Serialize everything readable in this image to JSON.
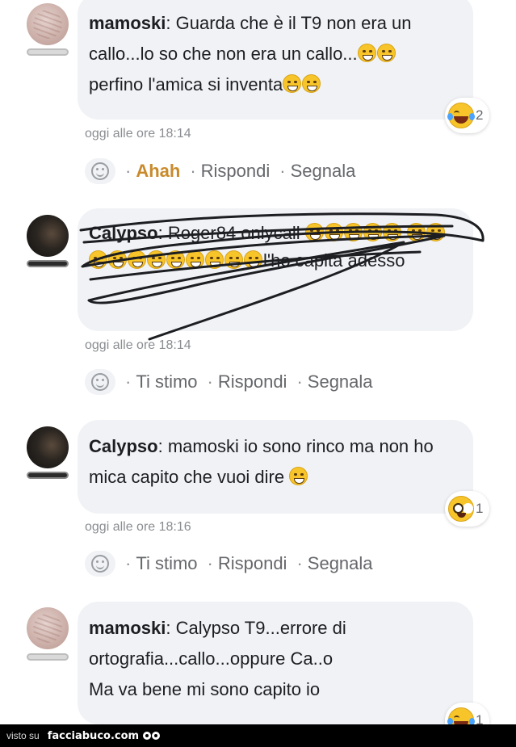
{
  "comments": [
    {
      "author": "mamoski",
      "text_before_emoji": ": Guarda che è il T9 non era un callo...lo so che non era un callo...",
      "text_line3": "perfino l'amica si inventa",
      "reaction": {
        "icon": "laugh-tears-reaction-icon",
        "count": "2"
      },
      "timestamp": "oggi alle ore 18:14",
      "actions": {
        "react": "Ahah",
        "reply": "Rispondi",
        "report": "Segnala"
      },
      "react_active": true
    },
    {
      "author": "Calypso",
      "text": ": Roger84 onlycall",
      "text_tail": "l'ho capita adesso",
      "timestamp": "oggi alle ore 18:14",
      "actions": {
        "react": "Ti stimo",
        "reply": "Rispondi",
        "report": "Segnala"
      },
      "react_active": false,
      "scribbled_out": true
    },
    {
      "author": "Calypso",
      "text": ": mamoski io sono rinco ma non ho mica capito che vuoi dire",
      "reaction": {
        "icon": "wow-reaction-icon",
        "count": "1"
      },
      "timestamp": "oggi alle ore 18:16",
      "actions": {
        "react": "Ti stimo",
        "reply": "Rispondi",
        "report": "Segnala"
      },
      "react_active": false
    },
    {
      "author": "mamoski",
      "text_line1": ": Calypso T9...errore di",
      "text_line2": "ortografia...callo...oppure Ca..o",
      "text_line3": "Ma va bene mi sono capito io",
      "reaction": {
        "icon": "laugh-tears-reaction-icon",
        "count": "1"
      }
    }
  ],
  "footer": {
    "visto": "visto su",
    "brand": "facciabuco.com"
  },
  "colors": {
    "bubble": "#f0f2f5",
    "active_reaction": "#c98a2b",
    "muted_text": "#65676b"
  }
}
